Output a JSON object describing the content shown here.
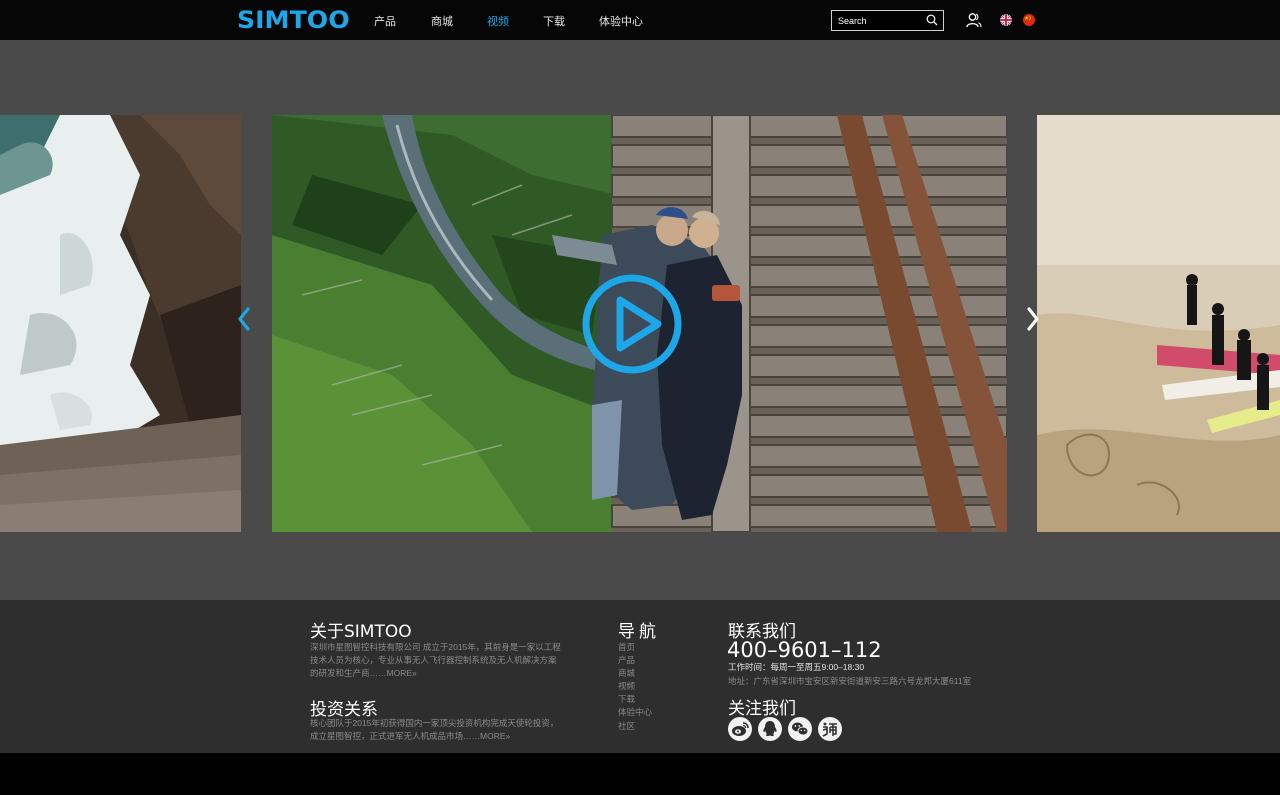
{
  "header": {
    "logo_text": "SIMTOO",
    "nav": [
      "产品",
      "商城",
      "视频",
      "下载",
      "体验中心"
    ],
    "active_nav": "视频",
    "search_placeholder": "Search",
    "languages": [
      "English",
      "中文"
    ]
  },
  "carousel": {
    "slides": [
      {
        "scene": "waterfall-rocks"
      },
      {
        "scene": "couple-on-railroad-bridge",
        "has_play_button": true
      },
      {
        "scene": "surfers-on-beach"
      }
    ],
    "current_index": 1
  },
  "footer": {
    "about": {
      "title": "关于SIMTOO",
      "text": "深圳市星图智控科技有限公司 成立于2015年，其前身是一家以工程技术人员为核心，专业从事无人飞行器控制系统及无人机解决方案的研发和生产商……",
      "more": "MORE»"
    },
    "invest": {
      "title": "投资关系",
      "text": "核心团队于2015年初获得国内一家顶尖投资机构完成天使轮投资，成立星图智控，正式进军无人机成品市场……",
      "more": "MORE»"
    },
    "navigation": {
      "title": "导航",
      "items": [
        "首页",
        "产品",
        "商城",
        "视频",
        "下载",
        "体验中心",
        "社区"
      ]
    },
    "contact": {
      "title": "联系我们",
      "phone": "400–9601–112",
      "hours": "工作时间：每周一至周五9:00–18:30",
      "address": "地址：广东省深圳市宝安区新安街道新安三路六号龙邦大厦611室"
    },
    "follow": {
      "title": "关注我们",
      "icons": [
        "weibo-icon",
        "qq-icon",
        "wechat-icon",
        "taobao-icon"
      ]
    }
  },
  "colors": {
    "accent": "#1ea7e8",
    "header_bg": "#060606",
    "stage_bg": "#4a4a4a",
    "footer_bg": "#2e2e2e"
  }
}
